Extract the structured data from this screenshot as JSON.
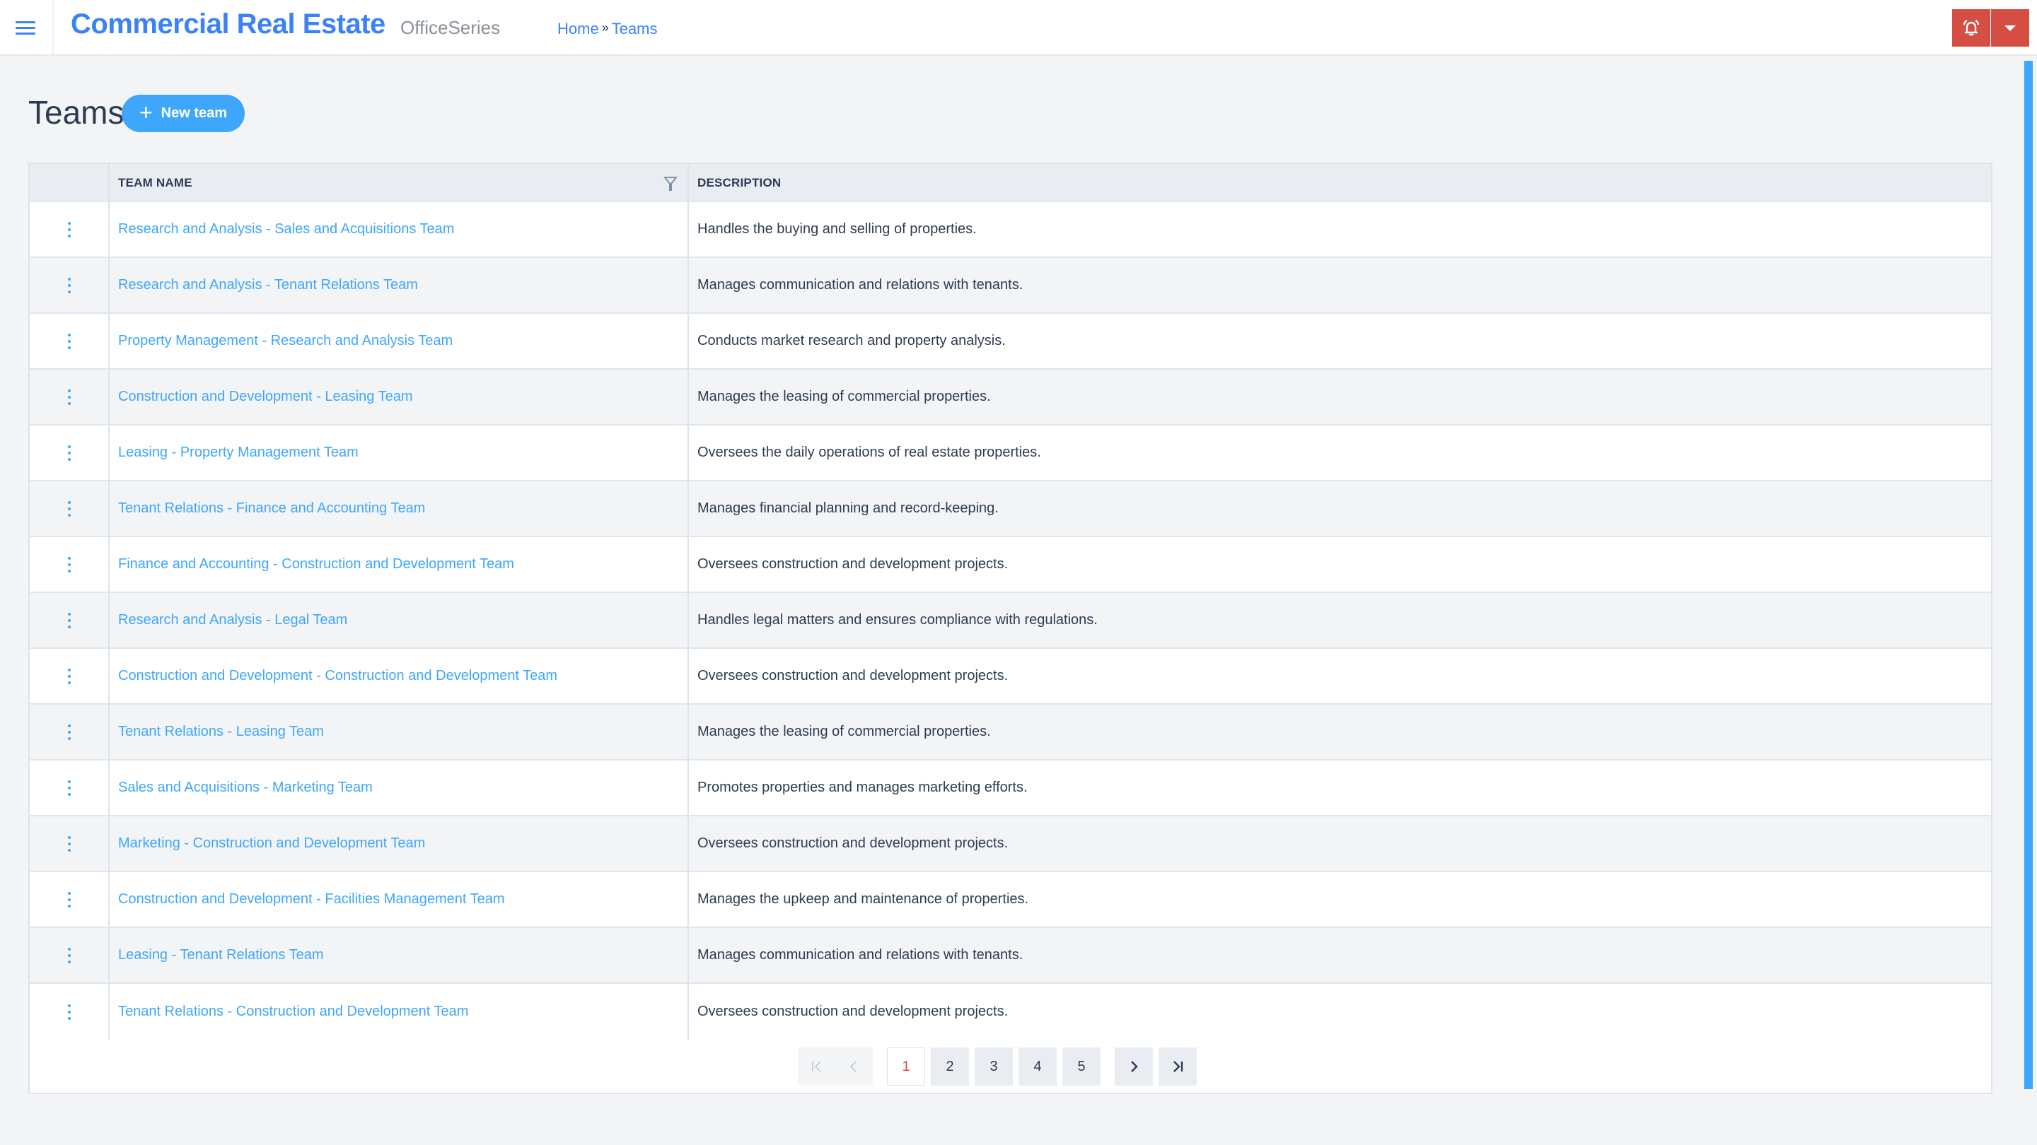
{
  "header": {
    "app_title": "Commercial Real Estate",
    "app_subtitle": "OfficeSeries",
    "breadcrumb": [
      {
        "label": "Home"
      },
      {
        "label": "Teams"
      }
    ],
    "breadcrumb_separator": "»",
    "menu_icon": "hamburger-menu-icon",
    "alert_icon": "bell-alert-icon",
    "dropdown_icon": "caret-down-icon",
    "accent_color": "#3b82f6",
    "alert_color": "#d64d43"
  },
  "page": {
    "title": "Teams",
    "new_button": {
      "icon": "plus-icon",
      "plus": "+",
      "label": "New team"
    }
  },
  "table": {
    "columns": [
      {
        "label": ""
      },
      {
        "label": "TEAM NAME",
        "filter_icon": "filter-icon"
      },
      {
        "label": "DESCRIPTION"
      }
    ],
    "rows": [
      {
        "name": "Research and Analysis - Sales and Acquisitions Team",
        "description": "Handles the buying and selling of properties."
      },
      {
        "name": "Research and Analysis - Tenant Relations Team",
        "description": "Manages communication and relations with tenants."
      },
      {
        "name": "Property Management - Research and Analysis Team",
        "description": "Conducts market research and property analysis."
      },
      {
        "name": "Construction and Development - Leasing Team",
        "description": "Manages the leasing of commercial properties."
      },
      {
        "name": "Leasing - Property Management Team",
        "description": "Oversees the daily operations of real estate properties."
      },
      {
        "name": "Tenant Relations - Finance and Accounting Team",
        "description": "Manages financial planning and record-keeping."
      },
      {
        "name": "Finance and Accounting - Construction and Development Team",
        "description": "Oversees construction and development projects."
      },
      {
        "name": "Research and Analysis - Legal Team",
        "description": "Handles legal matters and ensures compliance with regulations."
      },
      {
        "name": "Construction and Development - Construction and Development Team",
        "description": "Oversees construction and development projects."
      },
      {
        "name": "Tenant Relations - Leasing Team",
        "description": "Manages the leasing of commercial properties."
      },
      {
        "name": "Sales and Acquisitions - Marketing Team",
        "description": "Promotes properties and manages marketing efforts."
      },
      {
        "name": "Marketing - Construction and Development Team",
        "description": "Oversees construction and development projects."
      },
      {
        "name": "Construction and Development - Facilities Management Team",
        "description": "Manages the upkeep and maintenance of properties."
      },
      {
        "name": "Leasing - Tenant Relations Team",
        "description": "Manages communication and relations with tenants."
      },
      {
        "name": "Tenant Relations - Construction and Development Team",
        "description": "Oversees construction and development projects."
      }
    ],
    "row_action_icon": "kebab-menu-icon",
    "link_color": "#3ea6fb"
  },
  "pagination": {
    "first": "|<",
    "prev": "<",
    "pages": [
      "1",
      "2",
      "3",
      "4",
      "5"
    ],
    "current_page": "1",
    "next": ">",
    "last": ">|"
  }
}
